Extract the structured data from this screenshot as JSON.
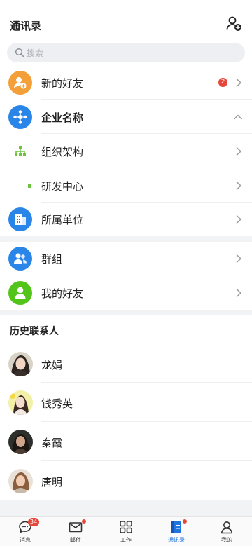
{
  "header": {
    "title": "通讯录",
    "add_contact_icon": "add-contact-icon"
  },
  "search": {
    "placeholder": "搜索",
    "icon": "search-icon"
  },
  "menu": {
    "new_friends": {
      "label": "新的好友",
      "badge": "2",
      "icon": "user-add-icon",
      "color": "#f4a03a"
    },
    "company": {
      "label": "企业名称",
      "icon": "network-icon",
      "color": "#2a85e8",
      "expanded": true
    },
    "org_structure": {
      "label": "组织架构",
      "icon": "org-tree-icon",
      "color": "#6cc33d"
    },
    "rd_center": {
      "label": "研发中心"
    },
    "affiliated_unit": {
      "label": "所属单位",
      "icon": "building-icon",
      "color": "#2a85e8"
    },
    "groups": {
      "label": "群组",
      "icon": "group-icon",
      "color": "#2a85e8"
    },
    "my_friends": {
      "label": "我的好友",
      "icon": "person-icon",
      "color": "#52c41a"
    }
  },
  "history": {
    "title": "历史联系人",
    "contacts": [
      {
        "name": "龙娟"
      },
      {
        "name": "钱秀英"
      },
      {
        "name": "秦霞"
      },
      {
        "name": "唐明"
      }
    ]
  },
  "tabbar": {
    "tabs": [
      {
        "label": "消息",
        "badge": "34",
        "icon": "chat-icon"
      },
      {
        "label": "邮件",
        "icon": "mail-icon",
        "dot": true
      },
      {
        "label": "工作",
        "icon": "grid-icon"
      },
      {
        "label": "通讯录",
        "icon": "contacts-book-icon",
        "dot": true,
        "active": true
      },
      {
        "label": "我的",
        "icon": "profile-icon"
      }
    ],
    "active_color": "#1f74e0"
  }
}
